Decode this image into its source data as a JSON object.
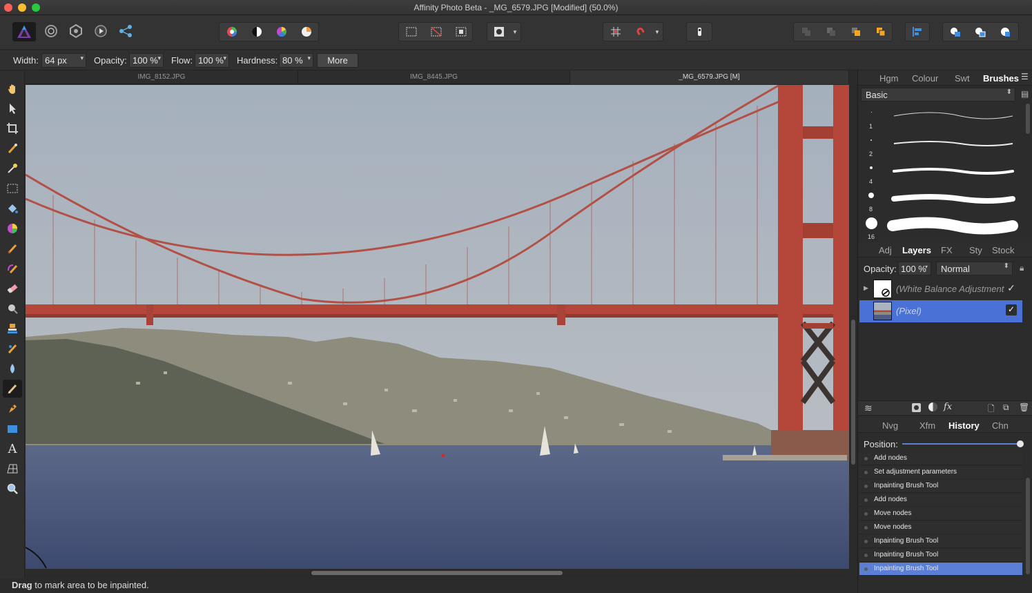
{
  "window": {
    "title": "Affinity Photo Beta - _MG_6579.JPG [Modified] (50.0%)"
  },
  "context": {
    "width_label": "Width:",
    "width_value": "64 px",
    "opacity_label": "Opacity:",
    "opacity_value": "100 %",
    "flow_label": "Flow:",
    "flow_value": "100 %",
    "hardness_label": "Hardness:",
    "hardness_value": "80 %",
    "more_label": "More"
  },
  "doc_tabs": [
    "IMG_8152.JPG",
    "IMG_8445.JPG",
    "_MG_6579.JPG [M]"
  ],
  "status": {
    "bold": "Drag",
    "text": " to mark area to be inpainted."
  },
  "panels": {
    "top_tabs": [
      "Hgm",
      "Colour",
      "Swt",
      "Brushes"
    ],
    "brush_category": "Basic",
    "brush_sizes": [
      "",
      "1",
      "2",
      "4",
      "8",
      "16"
    ],
    "mid_tabs": [
      "Adj",
      "Layers",
      "FX",
      "Sty",
      "Stock"
    ],
    "layer_opacity_label": "Opacity:",
    "layer_opacity_value": "100 %",
    "blend_mode": "Normal",
    "layers": [
      {
        "name": "(White Balance Adjustment",
        "checked": "✓"
      },
      {
        "name": "(Pixel)",
        "checked": "✓"
      }
    ],
    "bottom_tabs": [
      "Nvg",
      "Xfm",
      "History",
      "Chn"
    ],
    "position_label": "Position:",
    "history_position": 1.0,
    "history": [
      "Add nodes",
      "Set adjustment parameters",
      "Inpainting Brush Tool",
      "Add nodes",
      "Move nodes",
      "Move nodes",
      "Inpainting Brush Tool",
      "Inpainting Brush Tool",
      "Inpainting Brush Tool"
    ]
  },
  "colors": {
    "accent": "#4a72d6",
    "bridge": "#b5463a",
    "sky": "#a9b4c0",
    "water": "#4d5c82"
  }
}
